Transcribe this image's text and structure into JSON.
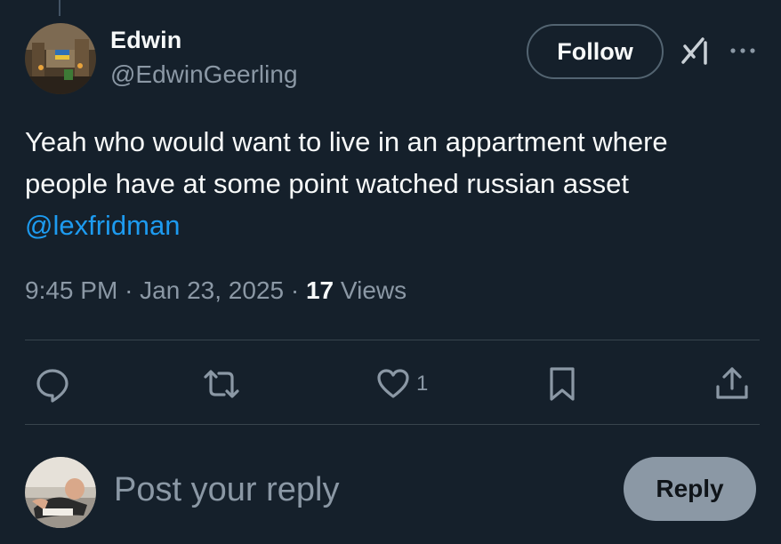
{
  "author": {
    "name": "Edwin",
    "handle": "@EdwinGeerling"
  },
  "header": {
    "follow_label": "Follow",
    "grok_icon": "grok-icon",
    "more_icon": "more-options-icon"
  },
  "tweet": {
    "text_line1": "Yeah who would want to live in an appartment where",
    "text_line2": "people have at some point watched russian asset",
    "mention": "@lexfridman"
  },
  "meta": {
    "time": "9:45 PM",
    "separator": "·",
    "date": "Jan 23, 2025",
    "views_count": "17",
    "views_label": "Views"
  },
  "actions": {
    "reply_icon": "reply-icon",
    "retweet_icon": "retweet-icon",
    "like_icon": "heart-icon",
    "like_count": "1",
    "bookmark_icon": "bookmark-icon",
    "share_icon": "share-icon"
  },
  "composer": {
    "placeholder": "Post your reply",
    "reply_label": "Reply"
  },
  "colors": {
    "background": "#15202b",
    "text": "#f7f9f9",
    "secondary": "#8b98a5",
    "link": "#1d9bf0",
    "divider": "#38444d"
  }
}
